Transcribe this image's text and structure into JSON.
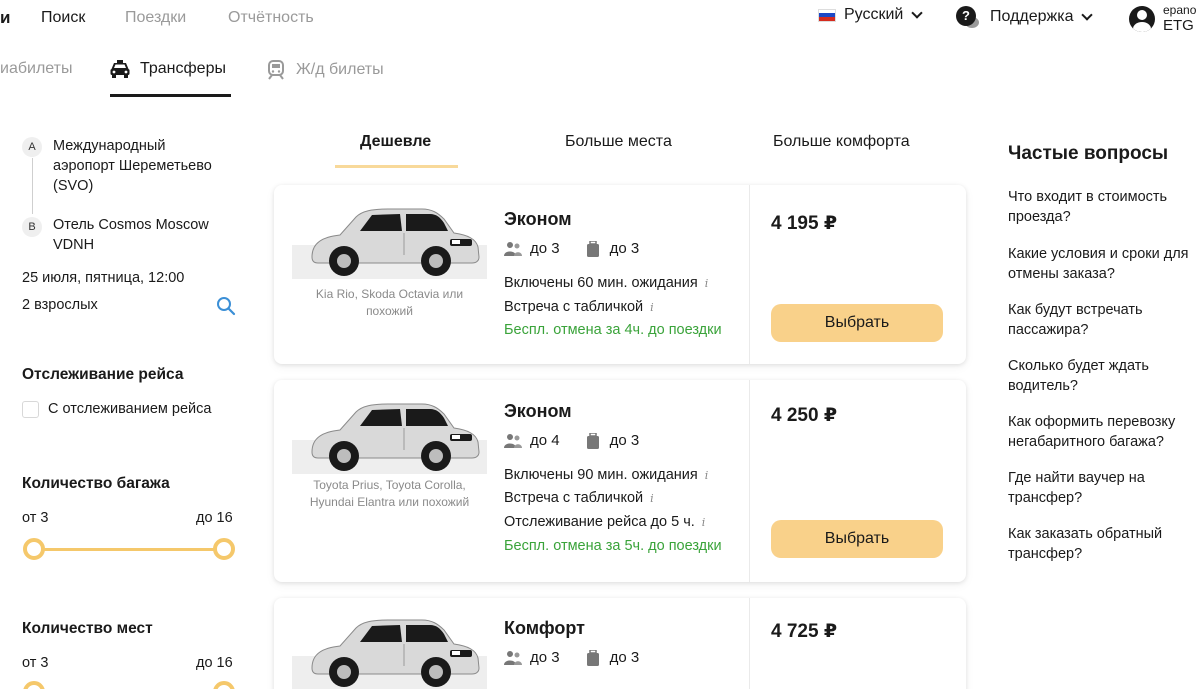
{
  "topnav": {
    "logo_fragment": "и",
    "items": [
      {
        "label": "Поиск",
        "active": true
      },
      {
        "label": "Поездки",
        "active": false
      },
      {
        "label": "Отчётность",
        "active": false
      }
    ],
    "language": "Русский",
    "support": "Поддержка",
    "user": {
      "name_fragment": "epanо",
      "company": "ETG"
    }
  },
  "product_tabs": [
    {
      "label": "иабилеты",
      "icon": "plane-icon",
      "active": false
    },
    {
      "label": "Трансферы",
      "icon": "taxi-icon",
      "active": true
    },
    {
      "label": "Ж/д билеты",
      "icon": "train-icon",
      "active": false
    }
  ],
  "route": {
    "from": {
      "badge": "A",
      "lines": [
        "Международный",
        "аэропорт Шереметьево",
        "(SVO)"
      ]
    },
    "to": {
      "badge": "B",
      "lines": [
        "Отель Cosmos Moscow",
        "VDNH"
      ]
    },
    "datetime": "25 июля, пятница, 12:00",
    "passengers": "2 взрослых"
  },
  "filters": {
    "tracking": {
      "title": "Отслеживание рейса",
      "option": "С отслеживанием рейса"
    },
    "luggage": {
      "title": "Количество багажа",
      "from": "от 3",
      "to": "до 16"
    },
    "seats": {
      "title": "Количество мест",
      "from": "от 3",
      "to": "до 16"
    }
  },
  "sort_tabs": [
    {
      "label": "Дешевле",
      "active": true
    },
    {
      "label": "Больше места",
      "active": false
    },
    {
      "label": "Больше комфорта",
      "active": false
    }
  ],
  "offers": [
    {
      "class": "Эконом",
      "caption": [
        "Kia Rio, Skoda Octavia или",
        "похожий"
      ],
      "passengers": "до 3",
      "bags": "до 3",
      "features": [
        "Включены 60 мин. ожидания",
        "Встреча с табличкой"
      ],
      "cancellation": "Беспл. отмена за 4ч. до поездки",
      "price": "4 195 ₽",
      "button": "Выбрать"
    },
    {
      "class": "Эконом",
      "caption": [
        "Toyota Prius, Toyota Corolla,",
        "Hyundai Elantra или похожий"
      ],
      "passengers": "до 4",
      "bags": "до 3",
      "features": [
        "Включены 90 мин. ожидания",
        "Встреча с табличкой",
        "Отслеживание рейса до 5 ч."
      ],
      "cancellation": "Беспл. отмена за 5ч. до поездки",
      "price": "4 250 ₽",
      "button": "Выбрать"
    },
    {
      "class": "Комфорт",
      "passengers": "до 3",
      "bags": "до 3",
      "price": "4 725 ₽"
    }
  ],
  "faq": {
    "title": "Частые вопросы",
    "questions": [
      [
        "Что входит в стоимость",
        "проезда?"
      ],
      [
        "Какие условия и сроки для",
        "отмены заказа?"
      ],
      [
        "Как будут встречать",
        "пассажира?"
      ],
      [
        "Сколько будет ждать",
        "водитель?"
      ],
      [
        "Как оформить перевозку",
        "негабаритного багажа?"
      ],
      [
        "Где найти ваучер на",
        "трансфер?"
      ],
      [
        "Как заказать обратный",
        "трансфер?"
      ]
    ]
  },
  "colors": {
    "accent": "#F9D18A",
    "slider": "#F5C86B",
    "green": "#3AA33A",
    "muted": "#9A9A9A",
    "search_blue": "#3B8FD6"
  }
}
